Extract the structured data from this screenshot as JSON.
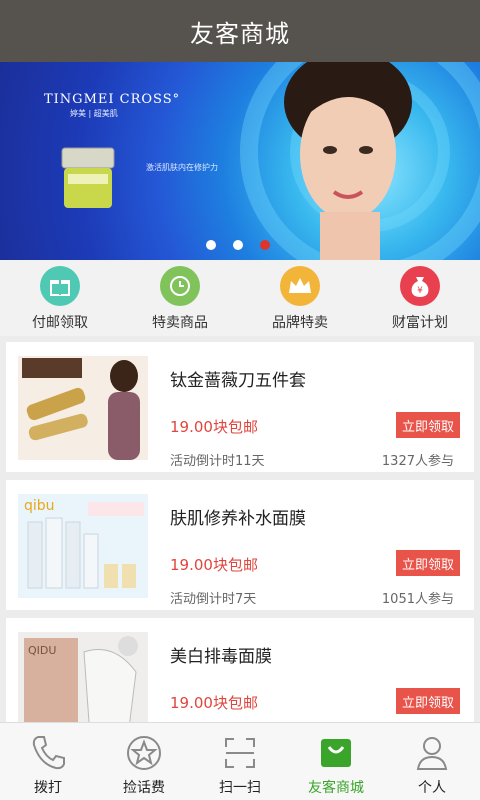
{
  "header": {
    "title": "友客商城"
  },
  "banner": {
    "brand": "TINGMEI CROSS°",
    "brand_sub": "婷美 | 超美肌",
    "tagline": "激活肌肤内在修护力",
    "slides": 3,
    "active_slide": 3
  },
  "quick_nav": [
    {
      "label": "付邮领取",
      "icon": "gift-icon",
      "color": "#4fc9b3"
    },
    {
      "label": "特卖商品",
      "icon": "clock-icon",
      "color": "#7fc35a"
    },
    {
      "label": "品牌特卖",
      "icon": "crown-icon",
      "color": "#f2b53a"
    },
    {
      "label": "财富计划",
      "icon": "money-bag-icon",
      "color": "#e8404e"
    }
  ],
  "products": [
    {
      "name": "钛金蔷薇刀五件套",
      "price": "19.00块包邮",
      "claim": "立即领取",
      "countdown": "活动倒计时11天",
      "joined": "1327人参与"
    },
    {
      "name": "肤肌修养补水面膜",
      "price": "19.00块包邮",
      "claim": "立即领取",
      "countdown": "活动倒计时7天",
      "joined": "1051人参与"
    },
    {
      "name": "美白排毒面膜",
      "price": "19.00块包邮",
      "claim": "立即领取",
      "countdown": "",
      "joined": ""
    }
  ],
  "tabs": [
    {
      "label": "拨打",
      "icon": "phone-icon"
    },
    {
      "label": "捡话费",
      "icon": "star-icon"
    },
    {
      "label": "扫一扫",
      "icon": "scan-icon"
    },
    {
      "label": "友客商城",
      "icon": "shopping-bag-icon",
      "active": true
    },
    {
      "label": "个人",
      "icon": "person-icon"
    }
  ],
  "colors": {
    "header": "#56524d",
    "accent_green": "#3aa52a",
    "price_red": "#e0453e",
    "claim_button": "#e8534a"
  }
}
